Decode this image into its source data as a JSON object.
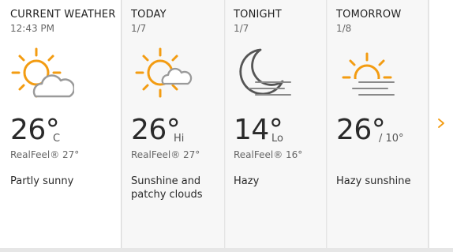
{
  "cards": [
    {
      "title": "CURRENT WEATHER",
      "subtitle": "12:43 PM",
      "icon": "partly-sunny-icon",
      "temp": "26°",
      "suffix": "C",
      "realfeel": "RealFeel® 27°",
      "phrase": "Partly sunny"
    },
    {
      "title": "TODAY",
      "subtitle": "1/7",
      "icon": "sunshine-patchy-clouds-icon",
      "temp": "26°",
      "suffix": "Hi",
      "realfeel": "RealFeel® 27°",
      "phrase": "Sunshine and patchy clouds"
    },
    {
      "title": "TONIGHT",
      "subtitle": "1/7",
      "icon": "hazy-moon-icon",
      "temp": "14°",
      "suffix": "Lo",
      "realfeel": "RealFeel® 16°",
      "phrase": "Hazy"
    },
    {
      "title": "TOMORROW",
      "subtitle": "1/8",
      "icon": "hazy-sunshine-icon",
      "temp": "26°",
      "suffix": "/ 10°",
      "realfeel": "",
      "phrase": "Hazy sunshine"
    }
  ],
  "next": {
    "icon": "chevron-right-icon"
  },
  "colors": {
    "sun": "#f39c12",
    "cloud": "#9a9a9a",
    "moon": "#555555",
    "haze": "#8a8a8a",
    "arrow": "#f39c12"
  }
}
